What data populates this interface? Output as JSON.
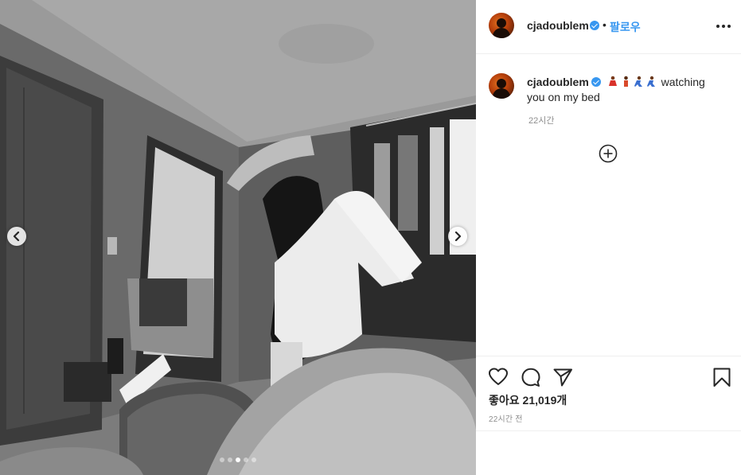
{
  "post": {
    "username": "cjadoublem",
    "follow_label": "팔로우",
    "caption_text": "watching you on my bed",
    "comment_time": "22시간",
    "likes": "좋아요 21,019개",
    "post_time": "22시간 전",
    "carousel": {
      "count": 5,
      "active_index": 2
    }
  },
  "colors": {
    "accent": "#3897f0",
    "text": "#262626",
    "muted": "#8e8e8e",
    "divider": "#efefef"
  },
  "icons": {
    "verified": "verified-badge-icon",
    "more": "more-options-icon",
    "add_comment": "plus-circle-icon",
    "like": "heart-icon",
    "comment": "comment-bubble-icon",
    "share": "paper-plane-icon",
    "save": "bookmark-icon",
    "prev": "chevron-left-icon",
    "next": "chevron-right-icon"
  }
}
